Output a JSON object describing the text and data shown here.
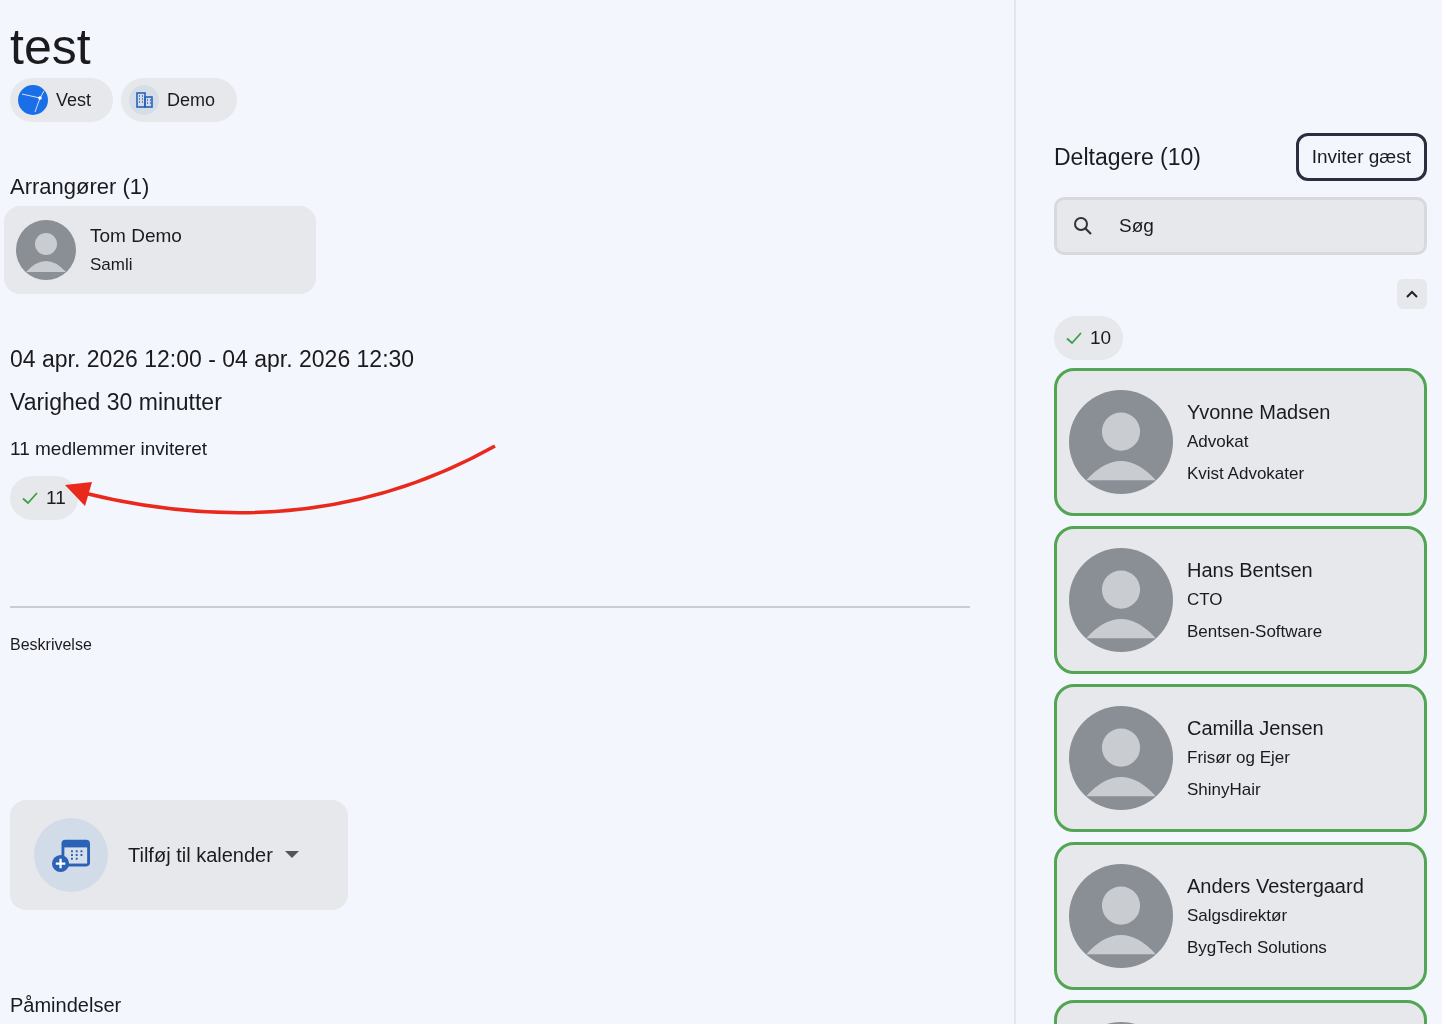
{
  "title": "test",
  "chips": [
    {
      "kind": "region",
      "label": "Vest"
    },
    {
      "kind": "organization",
      "label": "Demo"
    }
  ],
  "organizers": {
    "heading": "Arrangører (1)",
    "items": [
      {
        "name": "Tom Demo",
        "company": "Samli"
      }
    ]
  },
  "event": {
    "time": "04 apr. 2026 12:00 - 04 apr. 2026 12:30",
    "duration": "Varighed 30 minutter",
    "invited": "11 medlemmer inviteret",
    "accepted_count": "11"
  },
  "annotation": {
    "kind": "arrow",
    "color": "#e8291c"
  },
  "description": {
    "label": "Beskrivelse"
  },
  "calendar_button": {
    "label": "Tilføj til kalender"
  },
  "reminders": {
    "label": "Påmindelser"
  },
  "participants": {
    "heading": "Deltagere (10)",
    "invite_button": "Inviter gæst",
    "search": {
      "placeholder": "Søg"
    },
    "expanded": true,
    "accepted_count": "10",
    "items": [
      {
        "name": "Yvonne Madsen",
        "title": "Advokat",
        "company": "Kvist Advokater",
        "accepted": true
      },
      {
        "name": "Hans Bentsen",
        "title": "CTO",
        "company": "Bentsen-Software",
        "accepted": true
      },
      {
        "name": "Camilla Jensen",
        "title": "Frisør og Ejer",
        "company": "ShinyHair",
        "accepted": true
      },
      {
        "name": "Anders Vestergaard",
        "title": "Salgsdirektør",
        "company": "BygTech Solutions",
        "accepted": true
      },
      {
        "accepted": true
      }
    ]
  }
}
